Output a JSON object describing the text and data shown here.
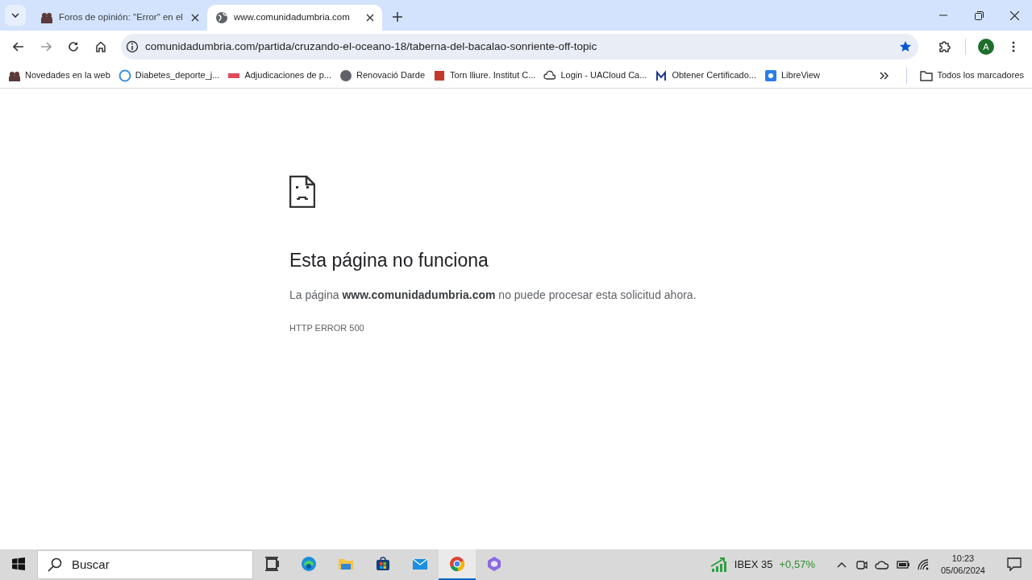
{
  "tabs": [
    {
      "title": "Foros de opinión: \"Error\" en el",
      "selected": false
    },
    {
      "title": "www.comunidadumbria.com",
      "selected": true
    }
  ],
  "address_bar": {
    "url": "comunidadumbria.com/partida/cruzando-el-oceano-18/taberna-del-bacalao-sonriente-off-topic",
    "bookmarked": true
  },
  "profile": {
    "initial": "A"
  },
  "bookmarks": [
    {
      "label": "Novedades en la web"
    },
    {
      "label": "Diabetes_deporte_j..."
    },
    {
      "label": "Adjudicaciones de p..."
    },
    {
      "label": "Renovació Darde"
    },
    {
      "label": "Torn lliure. Institut C..."
    },
    {
      "label": "Login - UACloud Ca..."
    },
    {
      "label": "Obtener Certificado..."
    },
    {
      "label": "LibreView"
    }
  ],
  "all_bookmarks": "Todos los marcadores",
  "error": {
    "heading": "Esta página no funciona",
    "message": "La página **www.comunidadumbria.com** no puede procesar esta solicitud ahora.",
    "code": "HTTP ERROR 500"
  },
  "taskbar": {
    "search_placeholder": "Buscar",
    "apps": [
      {
        "kind": "taskview",
        "selected": false
      },
      {
        "kind": "edge",
        "selected": false
      },
      {
        "kind": "folder",
        "selected": false
      },
      {
        "kind": "store",
        "selected": false
      },
      {
        "kind": "mail",
        "selected": false
      },
      {
        "kind": "chrome",
        "selected": true
      },
      {
        "kind": "assistant",
        "selected": false
      }
    ],
    "stock": {
      "name": "IBEX 35",
      "change": "+0,57%"
    },
    "time": "10:23",
    "date": "05/06/2024"
  }
}
